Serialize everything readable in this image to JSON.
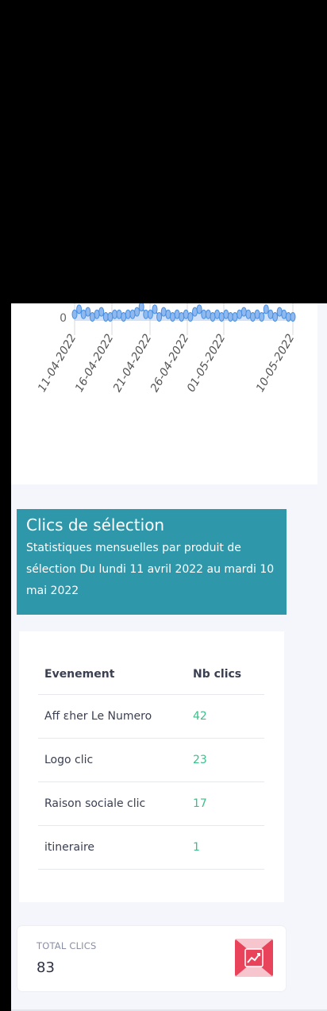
{
  "chart_data": {
    "type": "line",
    "x_tick_labels": [
      "11-04-2022",
      "16-04-2022",
      "21-04-2022",
      "26-04-2022",
      "01-05-2022",
      "10-05-2022"
    ],
    "y_tick_labels": [
      "0"
    ],
    "values": [
      1,
      3,
      1,
      2,
      0,
      1,
      2,
      0,
      0,
      1,
      1,
      0,
      1,
      1,
      2,
      4,
      1,
      1,
      3,
      0,
      2,
      1,
      0,
      1,
      0,
      1,
      0,
      2,
      3,
      1,
      1,
      0,
      1,
      0,
      1,
      0,
      0,
      1,
      2,
      1,
      0,
      1,
      0,
      3,
      1,
      0,
      2,
      1,
      0,
      0
    ],
    "series_color": "#4a90e2",
    "fill_color": "#a9c8f2"
  },
  "selection": {
    "title": "Clics de sélection",
    "subtitle": "Statistiques mensuelles par produit de sélection Du lundi 11 avril 2022 au mardi 10 mai 2022"
  },
  "table": {
    "headers": [
      "Evenement",
      "Nb clics"
    ],
    "rows": [
      {
        "event": "Aff ɛher Le Numero",
        "clicks": "42"
      },
      {
        "event": "Logo clic",
        "clicks": "23"
      },
      {
        "event": "Raison sociale clic",
        "clicks": "17"
      },
      {
        "event": "itineraire",
        "clicks": "1"
      }
    ]
  },
  "total": {
    "label": "TOTAL CLICS",
    "value": "83",
    "icon": "chart-trend-icon",
    "icon_color": "#e8435a"
  }
}
